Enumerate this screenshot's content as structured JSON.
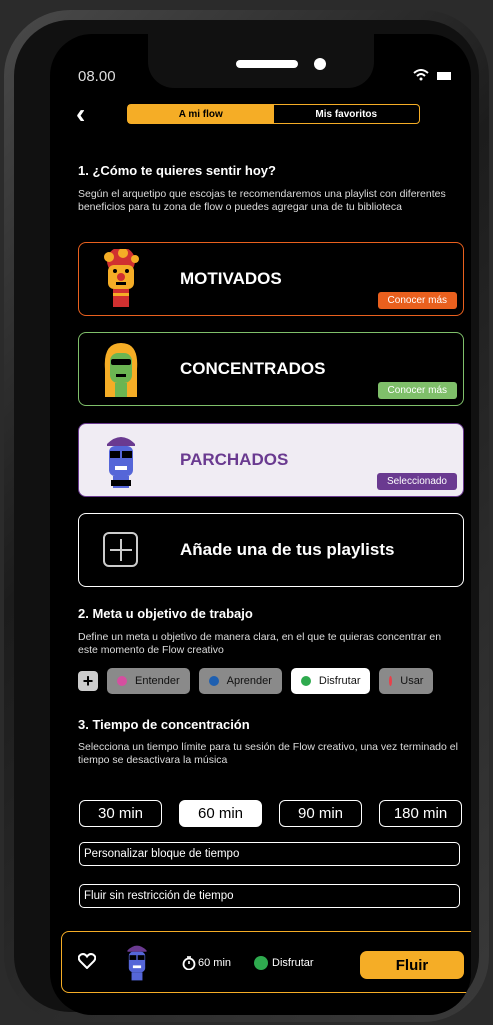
{
  "status": {
    "time": "08.00"
  },
  "tabs": [
    {
      "label": "A mi flow"
    },
    {
      "label": "Mis favoritos"
    }
  ],
  "section1": {
    "title": "1. ¿Cómo te quieres sentir  hoy?",
    "description": "Según el arquetipo que escojas te recomendaremos una playlist con diferentes beneficios para tu zona de flow o puedes agregar una de tu biblioteca"
  },
  "moods": [
    {
      "label": "MOTIVADOS",
      "button": "Conocer más",
      "color": "#e9601e"
    },
    {
      "label": "CONCENTRADOS",
      "button": "Conocer más",
      "color": "#7fbf6a"
    },
    {
      "label": "PARCHADOS",
      "button": "Seleccionado",
      "color": "#6a3a90"
    }
  ],
  "add_playlist": {
    "label": "Añade una de tus playlists"
  },
  "section2": {
    "title": "2. Meta u objetivo de trabajo",
    "description": "Define un meta u objetivo de manera clara, en el que te quieras concentrar en este momento de Flow creativo"
  },
  "goals": [
    {
      "label": "Entender",
      "color": "#d54fa0"
    },
    {
      "label": "Aprender",
      "color": "#1e5fb0"
    },
    {
      "label": "Disfrutar",
      "color": "#2eaa4e"
    },
    {
      "label": "Usar",
      "color": "#e8404a"
    }
  ],
  "section3": {
    "title": "3. Tiempo de concentración",
    "description": "Selecciona un tiempo límite para tu sesión de Flow creativo, una vez terminado el tiempo se desactivara la música"
  },
  "times": [
    "30 min",
    "60 min",
    "90 min",
    "180 min"
  ],
  "custom_time": "Personalizar bloque de tiempo",
  "no_limit": "Fluir sin restricción de tiempo",
  "player": {
    "time": "60 min",
    "goal": "Disfrutar",
    "action": "Fluir"
  }
}
